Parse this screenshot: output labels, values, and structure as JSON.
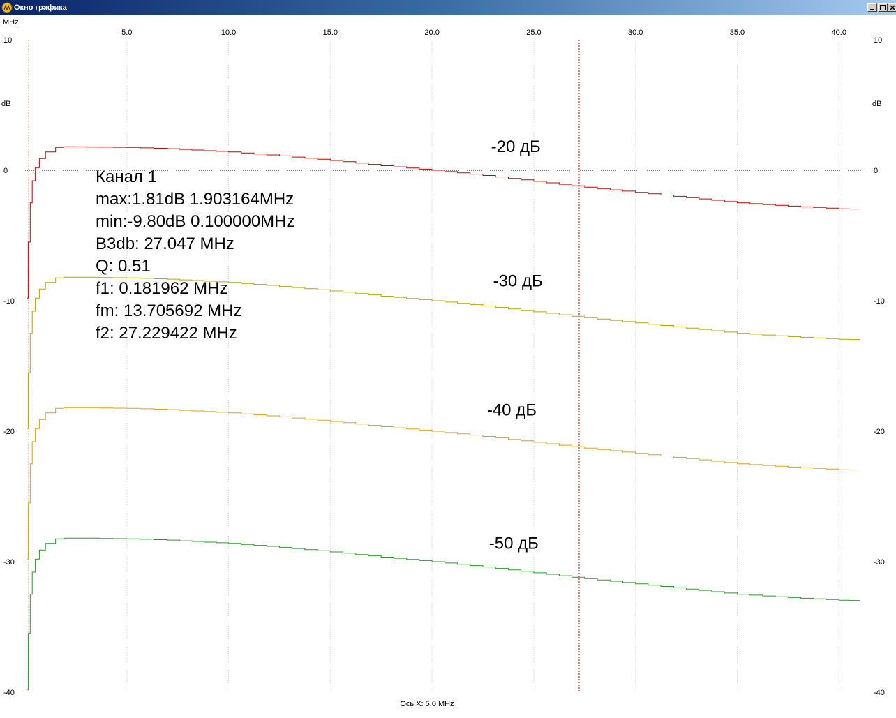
{
  "window": {
    "title": "Окно графика",
    "title_color": "#0a246a"
  },
  "chart_data": {
    "type": "line",
    "xlabel": "Ось X: 5.0 MHz",
    "x_unit_label": "MHz",
    "ylabel": "dB",
    "xlim": [
      0,
      41.5
    ],
    "ylim": [
      -40,
      10
    ],
    "x_ticks": [
      5.0,
      10.0,
      15.0,
      20.0,
      25.0,
      30.0,
      35.0,
      40.0
    ],
    "x_tick_labels": [
      "5.0",
      "10.0",
      "15.0",
      "20.0",
      "25.0",
      "30.0",
      "35.0",
      "40.0"
    ],
    "y_ticks": [
      10,
      0,
      -10,
      -20,
      -30,
      -40
    ],
    "y_tick_labels": [
      "10",
      "0",
      "-10",
      "-20",
      "-30",
      "-40"
    ],
    "grid": true,
    "reference_line_y": 0,
    "markers_x": [
      0.18,
      27.23
    ],
    "marker_color": "#cc0000",
    "series": [
      {
        "name": "-20 дБ",
        "color": "#cc0000",
        "x": [
          0.1,
          0.15,
          0.25,
          0.35,
          0.5,
          0.7,
          1.0,
          1.5,
          1.9,
          3.0,
          5.0,
          7.0,
          10.0,
          12.5,
          15.0,
          17.5,
          20.0,
          22.5,
          25.0,
          27.5,
          30.0,
          32.5,
          35.0,
          37.5,
          40.0,
          41.0
        ],
        "values": [
          -9.8,
          -5.5,
          -2.5,
          -0.8,
          0.2,
          0.9,
          1.4,
          1.75,
          1.81,
          1.78,
          1.75,
          1.65,
          1.4,
          1.1,
          0.75,
          0.35,
          0.0,
          -0.4,
          -0.85,
          -1.3,
          -1.7,
          -2.1,
          -2.5,
          -2.75,
          -2.95,
          -3.0
        ]
      },
      {
        "name": "-30 дБ",
        "color": "#b5a800",
        "x": [
          0.1,
          0.15,
          0.25,
          0.35,
          0.5,
          0.7,
          1.0,
          1.5,
          1.9,
          3.0,
          5.0,
          7.0,
          10.0,
          12.5,
          15.0,
          17.5,
          20.0,
          22.5,
          25.0,
          27.5,
          30.0,
          32.5,
          35.0,
          37.5,
          40.0,
          41.0
        ],
        "values": [
          -19.8,
          -15.5,
          -12.5,
          -10.8,
          -9.8,
          -9.1,
          -8.6,
          -8.25,
          -8.19,
          -8.2,
          -8.25,
          -8.35,
          -8.6,
          -8.9,
          -9.25,
          -9.65,
          -10.0,
          -10.4,
          -10.85,
          -11.3,
          -11.7,
          -12.1,
          -12.5,
          -12.75,
          -12.95,
          -13.0
        ]
      },
      {
        "name": "-40 дБ",
        "color": "#e0a010",
        "x": [
          0.1,
          0.15,
          0.25,
          0.35,
          0.5,
          0.7,
          1.0,
          1.5,
          1.9,
          3.0,
          5.0,
          7.0,
          10.0,
          12.5,
          15.0,
          17.5,
          20.0,
          22.5,
          25.0,
          27.5,
          30.0,
          32.5,
          35.0,
          37.5,
          40.0,
          41.0
        ],
        "values": [
          -29.8,
          -25.5,
          -22.5,
          -20.8,
          -19.8,
          -19.1,
          -18.6,
          -18.25,
          -18.19,
          -18.2,
          -18.25,
          -18.35,
          -18.6,
          -18.9,
          -19.25,
          -19.65,
          -20.0,
          -20.4,
          -20.85,
          -21.3,
          -21.7,
          -22.1,
          -22.5,
          -22.75,
          -22.95,
          -23.0
        ]
      },
      {
        "name": "-50 дБ",
        "color": "#2a9a2a",
        "x": [
          0.1,
          0.15,
          0.25,
          0.35,
          0.5,
          0.7,
          1.0,
          1.5,
          1.9,
          3.0,
          5.0,
          7.0,
          10.0,
          12.5,
          15.0,
          17.5,
          20.0,
          22.5,
          25.0,
          27.5,
          30.0,
          32.5,
          35.0,
          37.5,
          40.0,
          41.0
        ],
        "values": [
          -39.8,
          -35.5,
          -32.5,
          -30.8,
          -29.8,
          -29.1,
          -28.6,
          -28.25,
          -28.19,
          -28.2,
          -28.25,
          -28.35,
          -28.6,
          -28.9,
          -29.25,
          -29.65,
          -30.0,
          -30.4,
          -30.85,
          -31.3,
          -31.7,
          -32.1,
          -32.5,
          -32.75,
          -32.95,
          -33.0
        ]
      }
    ],
    "series_labels": [
      {
        "text": "-20 дБ",
        "x": 22.9,
        "y": 1.4
      },
      {
        "text": "-30 дБ",
        "x": 23.0,
        "y": -8.9
      },
      {
        "text": "-40 дБ",
        "x": 22.7,
        "y": -18.8
      },
      {
        "text": "-50 дБ",
        "x": 22.8,
        "y": -29.0
      }
    ]
  },
  "info": {
    "channel": "Канал 1",
    "max": "max:1.81dB 1.903164MHz",
    "min": "min:-9.80dB 0.100000MHz",
    "b3db": "B3db: 27.047 MHz",
    "q": "Q: 0.51",
    "f1": "f1: 0.181962 MHz",
    "fm": "fm: 13.705692 MHz",
    "f2": "f2: 27.229422 MHz"
  }
}
